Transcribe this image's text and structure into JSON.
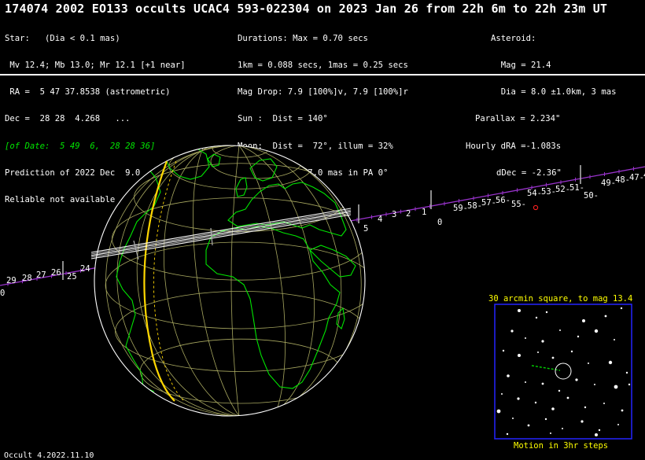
{
  "header": {
    "title": "174074 2002 EO133 occults UCAC4 593-022304 on 2023 Jan 26 from 22h  6m to 22h 23m UT"
  },
  "star_block": {
    "lines": [
      "Star:   (Dia < 0.1 mas)",
      " Mv 12.4; Mb 13.0; Mr 12.1 [+1 near]",
      " RA =  5 47 37.8538 (astrometric)",
      "Dec =  28 28  4.268   ...",
      "[of Date:  5 49  6,  28 28 36]",
      "Prediction of 2022 Dec  9.0",
      "Reliable not available"
    ]
  },
  "durations_block": {
    "lines": [
      "Durations: Max = 0.70 secs",
      "1km = 0.088 secs, 1mas = 0.25 secs",
      "Mag Drop: 7.9 [100%]v, 7.9 [100%]r",
      "Sun :  Dist = 140°",
      "Moon:  Dist =  72°, illum = 32%",
      "Error 29.0 x 27.0 mas in PA 0°"
    ]
  },
  "asteroid_block": {
    "lines": [
      "Asteroid:",
      "  Mag = 21.4",
      "  Dia = 8.0 ±1.0km, 3 mas",
      "Parallax = 2.234\"",
      "Hourly dRA =-1.083s",
      "dDec = -2.36\""
    ]
  },
  "track": {
    "minute_labels_right": [
      "5",
      "4",
      "3",
      "2",
      "1",
      "0",
      "59-",
      "58-",
      "57-",
      "56-",
      "55-",
      "54-",
      "53-",
      "52-",
      "51-",
      "50-",
      "49-",
      "48-",
      "47-",
      "4"
    ],
    "minute_labels_left": [
      "29",
      "28",
      "27",
      "26",
      "25",
      "24",
      "0"
    ]
  },
  "star_chart": {
    "title": "30 arcmin square, to mag 13.4",
    "footer": "Motion in 3hr steps"
  },
  "footer": {
    "version": "Occult 4.2022.11.10"
  },
  "colors": {
    "background": "#000000",
    "text": "#ffffff",
    "coastline": "#00e600",
    "graticule": "#a8a860",
    "track": "#9933cc",
    "shadow": "#ffffff",
    "terminator": "#ffd700",
    "star_chart_border": "#2424ff",
    "star_chart_text": "#ffff00",
    "target_marker": "#ff2020"
  }
}
